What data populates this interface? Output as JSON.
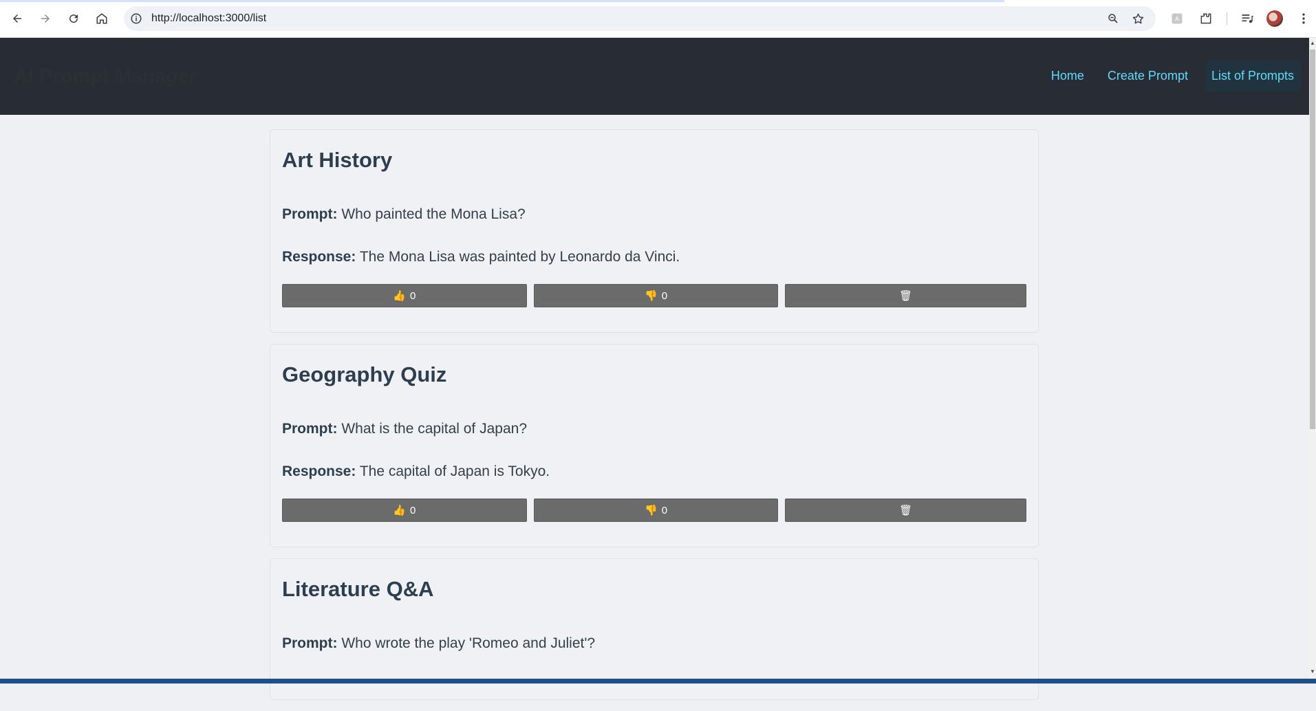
{
  "browser": {
    "url": "http://localhost:3000/list",
    "back_icon": "arrow-left-icon",
    "forward_icon": "arrow-right-icon",
    "reload_icon": "reload-icon",
    "home_icon": "home-icon"
  },
  "header": {
    "brand": "AI Prompt Manager",
    "nav": [
      {
        "label": "Home"
      },
      {
        "label": "Create Prompt"
      },
      {
        "label": "List of Prompts"
      }
    ]
  },
  "labels": {
    "prompt": "Prompt:",
    "response": "Response:"
  },
  "cards": [
    {
      "title": "Art History",
      "prompt": "Who painted the Mona Lisa?",
      "response": "The Mona Lisa was painted by Leonardo da Vinci.",
      "likes": "0",
      "dislikes": "0"
    },
    {
      "title": "Geography Quiz",
      "prompt": "What is the capital of Japan?",
      "response": "The capital of Japan is Tokyo.",
      "likes": "0",
      "dislikes": "0"
    },
    {
      "title": "Literature Q&A",
      "prompt": "Who wrote the play 'Romeo and Juliet'?"
    }
  ],
  "icons": {
    "like": "👍",
    "dislike": "👎",
    "delete": "🗑"
  },
  "colors": {
    "header_bg": "#282c34",
    "nav_link": "#61dafb",
    "button_bg": "#6b6b6b"
  }
}
